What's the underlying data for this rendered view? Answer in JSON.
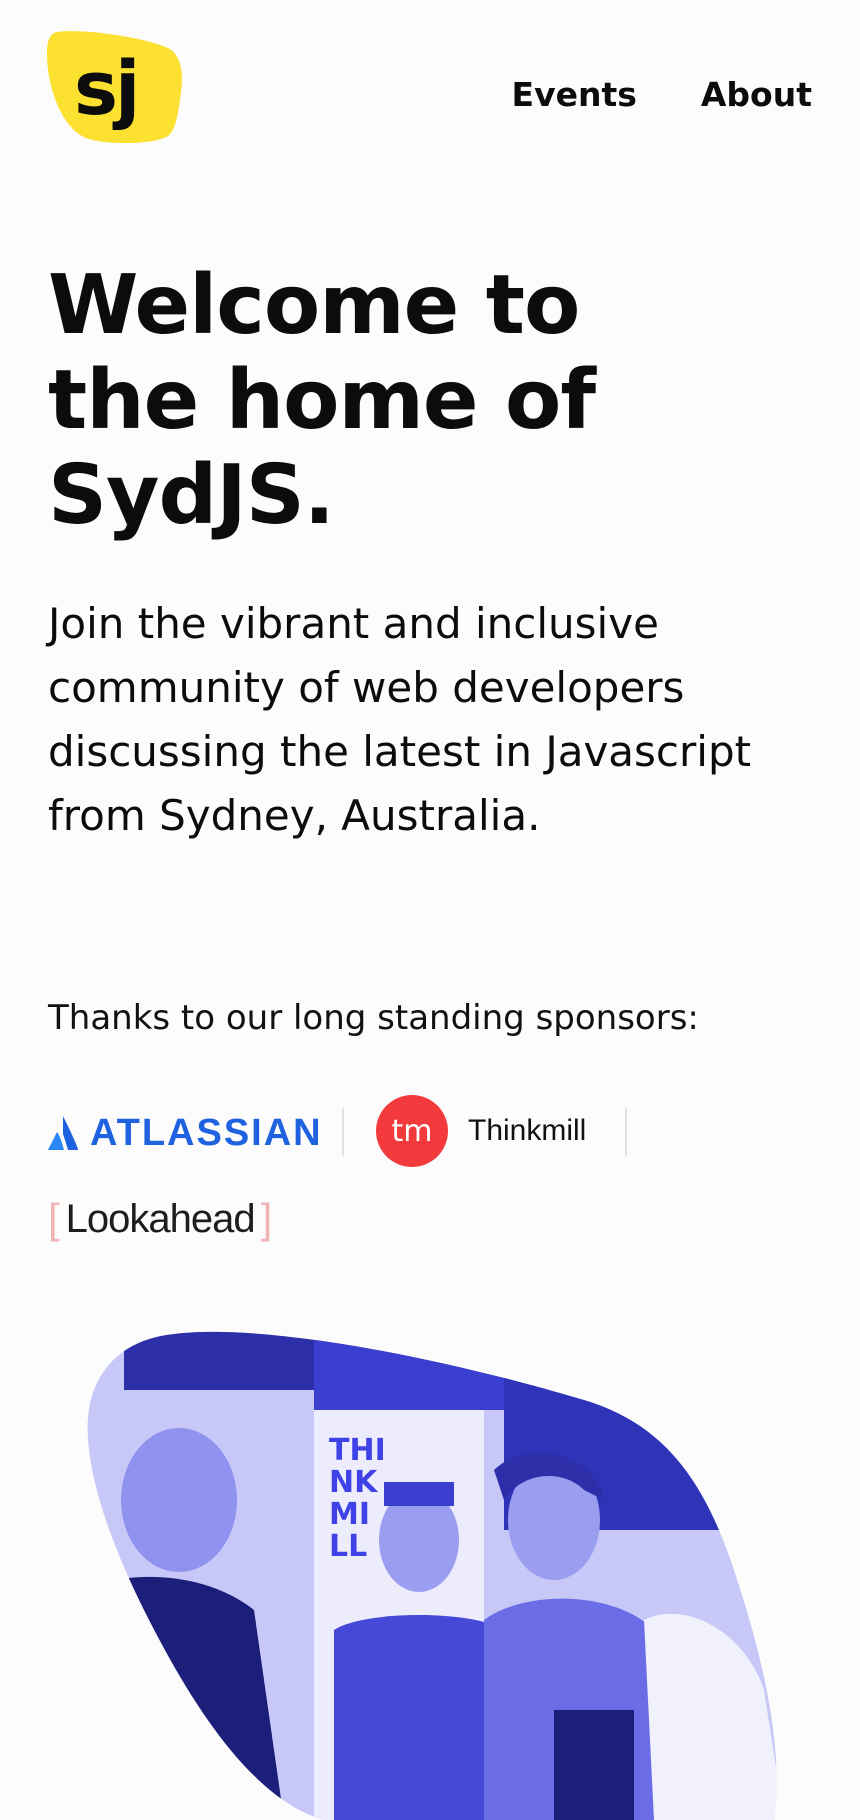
{
  "header": {
    "logo_text": "sj",
    "nav": [
      {
        "label": "Events"
      },
      {
        "label": "About"
      }
    ]
  },
  "hero": {
    "title": "Welcome to the home of SydJS.",
    "subtitle": "Join the vibrant and inclusive community of web developers discussing the latest in Javascript from Sydney, Australia."
  },
  "sponsors": {
    "intro": "Thanks to our long standing sponsors:",
    "items": [
      {
        "name": "ATLASSIAN"
      },
      {
        "name": "Thinkmill",
        "badge": "tm"
      },
      {
        "name": "Lookahead"
      }
    ]
  },
  "photo": {
    "banner_text": [
      "THI",
      "NK",
      "MI",
      "LL"
    ]
  },
  "colors": {
    "logo_yellow": "#fde131",
    "atlassian_blue": "#1f62df",
    "thinkmill_red": "#f23a3c",
    "lookahead_bracket": "#efb3b3",
    "photo_tint": "#3f42e6"
  }
}
